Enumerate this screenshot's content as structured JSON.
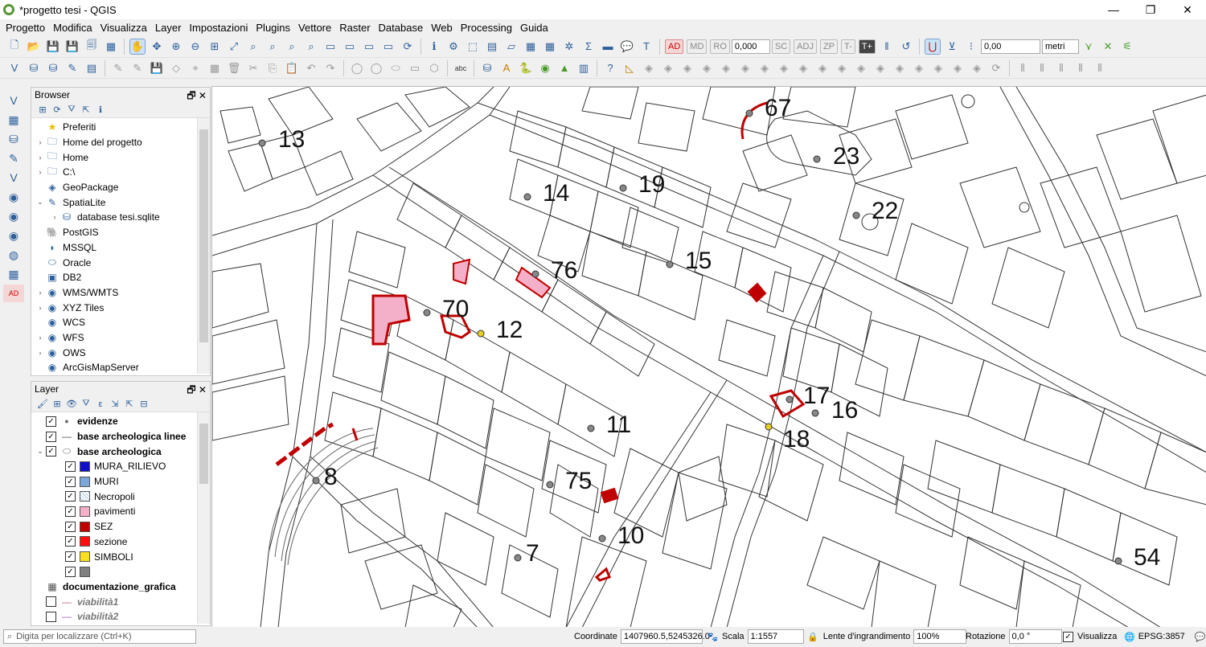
{
  "window": {
    "title": "*progetto tesi - QGIS",
    "minimize": "—",
    "maximize": "❐",
    "close": "✕"
  },
  "menu": [
    "Progetto",
    "Modifica",
    "Visualizza",
    "Layer",
    "Impostazioni",
    "Plugins",
    "Vettore",
    "Raster",
    "Database",
    "Web",
    "Processing",
    "Guida"
  ],
  "toolbar": {
    "snap_value": "0,000",
    "tolerance_value": "0,00",
    "units": "metri",
    "label_buttons": [
      "AD",
      "MD",
      "RO",
      "SC",
      "ADJ",
      "ZP",
      "T-",
      "T+"
    ]
  },
  "browser": {
    "title": "Browser",
    "items": [
      {
        "label": "Preferiti",
        "icon": "star-icon",
        "expander": "",
        "indent": 0
      },
      {
        "label": "Home del progetto",
        "icon": "folder-icon",
        "expander": "›",
        "indent": 0
      },
      {
        "label": "Home",
        "icon": "folder-icon",
        "expander": "›",
        "indent": 0
      },
      {
        "label": "C:\\",
        "icon": "folder-icon",
        "expander": "›",
        "indent": 0
      },
      {
        "label": "GeoPackage",
        "icon": "geopackage-icon",
        "expander": "",
        "indent": 0
      },
      {
        "label": "SpatiaLite",
        "icon": "spatialite-icon",
        "expander": "⌄",
        "indent": 0
      },
      {
        "label": "database tesi.sqlite",
        "icon": "database-icon",
        "expander": "›",
        "indent": 1
      },
      {
        "label": "PostGIS",
        "icon": "postgis-icon",
        "expander": "",
        "indent": 0
      },
      {
        "label": "MSSQL",
        "icon": "mssql-icon",
        "expander": "",
        "indent": 0
      },
      {
        "label": "Oracle",
        "icon": "oracle-icon",
        "expander": "",
        "indent": 0
      },
      {
        "label": "DB2",
        "icon": "db2-icon",
        "expander": "",
        "indent": 0
      },
      {
        "label": "WMS/WMTS",
        "icon": "globe-icon",
        "expander": "›",
        "indent": 0
      },
      {
        "label": "XYZ Tiles",
        "icon": "globe-icon",
        "expander": "›",
        "indent": 0
      },
      {
        "label": "WCS",
        "icon": "globe-icon",
        "expander": "",
        "indent": 0
      },
      {
        "label": "WFS",
        "icon": "globe-icon",
        "expander": "›",
        "indent": 0
      },
      {
        "label": "OWS",
        "icon": "globe-icon",
        "expander": "›",
        "indent": 0
      },
      {
        "label": "ArcGisMapServer",
        "icon": "globe-icon",
        "expander": "",
        "indent": 0
      }
    ]
  },
  "layers": {
    "title": "Layer",
    "items": [
      {
        "label": "evidenze",
        "checked": true,
        "style": "bold",
        "symbol": "point",
        "indent": 0,
        "expander": ""
      },
      {
        "label": "base archeologica linee",
        "checked": true,
        "style": "bold",
        "symbol": "line",
        "indent": 0,
        "expander": ""
      },
      {
        "label": "base archeologica",
        "checked": true,
        "style": "bold",
        "symbol": "polygon",
        "indent": 0,
        "expander": "⌄"
      },
      {
        "label": "MURA_RILIEVO",
        "checked": true,
        "style": "normal",
        "symbol": "swatch",
        "color": "#1010c8",
        "indent": 1
      },
      {
        "label": "MURI",
        "checked": true,
        "style": "normal",
        "symbol": "swatch",
        "color": "#7aa6d8",
        "indent": 1
      },
      {
        "label": "Necropoli",
        "checked": true,
        "style": "normal",
        "symbol": "hatch",
        "color": "#a8c8e8",
        "indent": 1
      },
      {
        "label": "pavimenti",
        "checked": true,
        "style": "normal",
        "symbol": "swatch",
        "color": "#f4b0c8",
        "indent": 1
      },
      {
        "label": "SEZ",
        "checked": true,
        "style": "normal",
        "symbol": "swatch",
        "color": "#c00000",
        "indent": 1
      },
      {
        "label": "sezione",
        "checked": true,
        "style": "normal",
        "symbol": "swatch",
        "color": "#ff1010",
        "indent": 1
      },
      {
        "label": "SIMBOLI",
        "checked": true,
        "style": "normal",
        "symbol": "swatch",
        "color": "#f8e020",
        "indent": 1
      },
      {
        "label": "",
        "checked": true,
        "style": "normal",
        "symbol": "swatch",
        "color": "#808080",
        "indent": 1
      },
      {
        "label": "documentazione_grafica",
        "checked": null,
        "style": "bold",
        "symbol": "table",
        "indent": 0
      },
      {
        "label": "viabilità1",
        "checked": false,
        "style": "italic",
        "symbol": "line",
        "color": "#c06080",
        "indent": 0
      },
      {
        "label": "viabilità2",
        "checked": false,
        "style": "italic",
        "symbol": "line",
        "color": "#a060c0",
        "indent": 0
      }
    ]
  },
  "map": {
    "labels": [
      "13",
      "67",
      "23",
      "14",
      "19",
      "22",
      "15",
      "76",
      "70",
      "12",
      "17",
      "16",
      "11",
      "18",
      "8",
      "75",
      "10",
      "7",
      "54"
    ]
  },
  "status": {
    "locator_placeholder": "Digita per localizzare (Ctrl+K)",
    "coordinate_label": "Coordinate",
    "coordinate_value": "1407960.5,5245326.0",
    "scale_label": "Scala",
    "scale_value": "1:1557",
    "magnifier_label": "Lente d'ingrandimento",
    "magnifier_value": "100%",
    "rotation_label": "Rotazione",
    "rotation_value": "0,0 °",
    "render_label": "Visualizza",
    "crs": "EPSG:3857"
  }
}
